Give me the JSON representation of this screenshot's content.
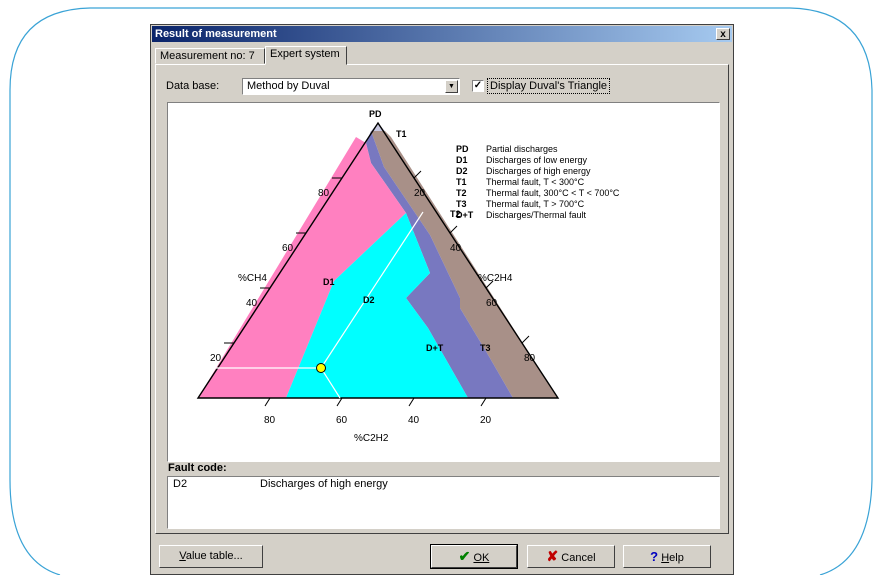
{
  "window": {
    "title": "Result of measurement",
    "close_glyph": "x"
  },
  "tabs": [
    {
      "label": "Measurement no: 7"
    },
    {
      "label": "Expert system"
    }
  ],
  "database": {
    "label": "Data base:",
    "value": "Method by Duval"
  },
  "display_triangle": {
    "label": "Display Duval's Triangle",
    "checked": true
  },
  "triangle": {
    "apex_label": "PD",
    "zone_labels": {
      "T1": "T1",
      "T2": "T2",
      "D1": "D1",
      "D2": "D2",
      "DT": "D+T",
      "T3": "T3"
    },
    "axis_ch4": {
      "label": "%CH4",
      "ticks": [
        "80",
        "60",
        "40",
        "20"
      ]
    },
    "axis_c2h4": {
      "label": "%C2H4",
      "ticks": [
        "20",
        "40",
        "60",
        "80"
      ]
    },
    "axis_c2h2": {
      "label": "%C2H2",
      "ticks": [
        "80",
        "60",
        "40",
        "20"
      ]
    },
    "zone_colors": {
      "D1": "#ff80c0",
      "D2": "#00ffff",
      "DT": "#8080c8",
      "T": "#a89088",
      "PD": "#c8c8e0"
    },
    "point_color": "#ffff00",
    "legend": [
      {
        "code": "PD",
        "text": "Partial discharges"
      },
      {
        "code": "D1",
        "text": "Discharges of low energy"
      },
      {
        "code": "D2",
        "text": "Discharges of high energy"
      },
      {
        "code": "T1",
        "text": "Thermal fault, T < 300°C"
      },
      {
        "code": "T2",
        "text": "Thermal fault, 300°C < T < 700°C"
      },
      {
        "code": "T3",
        "text": "Thermal fault, T > 700°C"
      },
      {
        "code": "D+T",
        "text": "Discharges/Thermal fault"
      }
    ]
  },
  "fault": {
    "label": "Fault code:",
    "code": "D2",
    "description": "Discharges of high energy"
  },
  "buttons": {
    "value_table": {
      "u": "V",
      "rest": "alue table..."
    },
    "ok": {
      "u": "",
      "rest": "OK",
      "icon": "check-icon"
    },
    "cancel": {
      "rest": "Cancel",
      "icon": "x-icon"
    },
    "help": {
      "u": "H",
      "rest": "elp",
      "icon": "question-icon"
    }
  }
}
